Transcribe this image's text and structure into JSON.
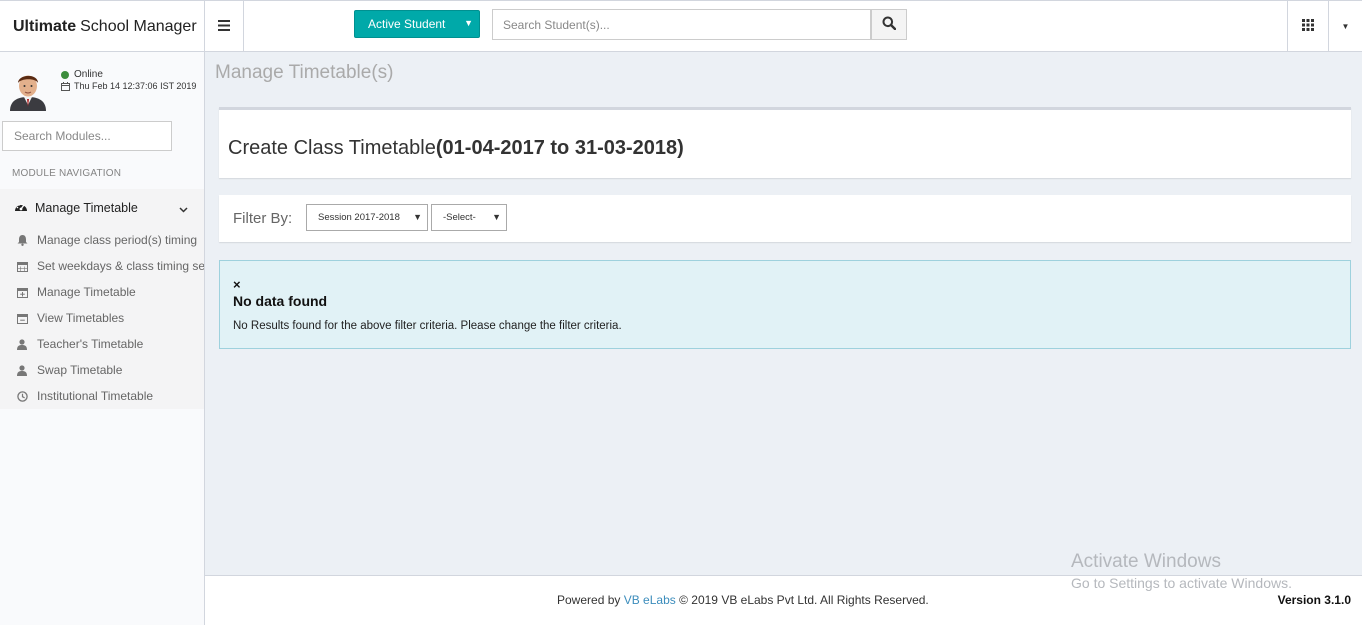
{
  "header": {
    "brand_bold": "Ultimate",
    "brand_rest": "School Manager",
    "student_dropdown_label": "Active Student",
    "search_placeholder": "Search Student(s)..."
  },
  "sidebar": {
    "user_status": "Online",
    "datetime": "Thu Feb 14 12:37:06 IST 2019",
    "module_search_placeholder": "Search Modules...",
    "nav_header": "MODULE NAVIGATION",
    "active_menu": "Manage Timetable",
    "items": [
      {
        "label": "Manage class period(s) timing",
        "icon": "bell-icon"
      },
      {
        "label": "Set weekdays & class timing sets",
        "icon": "calendar-icon"
      },
      {
        "label": "Manage Timetable",
        "icon": "calendar-plus-icon"
      },
      {
        "label": "View Timetables",
        "icon": "calendar-minus-icon"
      },
      {
        "label": "Teacher's Timetable",
        "icon": "user-icon"
      },
      {
        "label": "Swap Timetable",
        "icon": "user-icon"
      },
      {
        "label": "Institutional Timetable",
        "icon": "clock-icon"
      }
    ]
  },
  "main": {
    "page_title": "Manage Timetable(s)",
    "create_title_prefix": "Create Class Timetable",
    "create_title_range": "(01-04-2017 to 31-03-2018)",
    "filter_label": "Filter By:",
    "session_select": "Session 2017-2018",
    "other_select": "-Select-",
    "alert_close": "×",
    "alert_title": "No data found",
    "alert_text": "No Results found for the above filter criteria. Please change the filter criteria."
  },
  "footer": {
    "powered_by": "Powered by",
    "company_link": "VB eLabs",
    "copyright": "© 2019 VB eLabs Pvt Ltd. All Rights Reserved.",
    "version": "Version 3.1.0"
  },
  "watermark": {
    "line1": "Activate Windows",
    "line2": "Go to Settings to activate Windows."
  },
  "colors": {
    "accent_teal": "#00a9a9",
    "online_green": "#3c8d3c",
    "link_blue": "#3c8dbc",
    "alert_bg": "#e1f2f6"
  }
}
